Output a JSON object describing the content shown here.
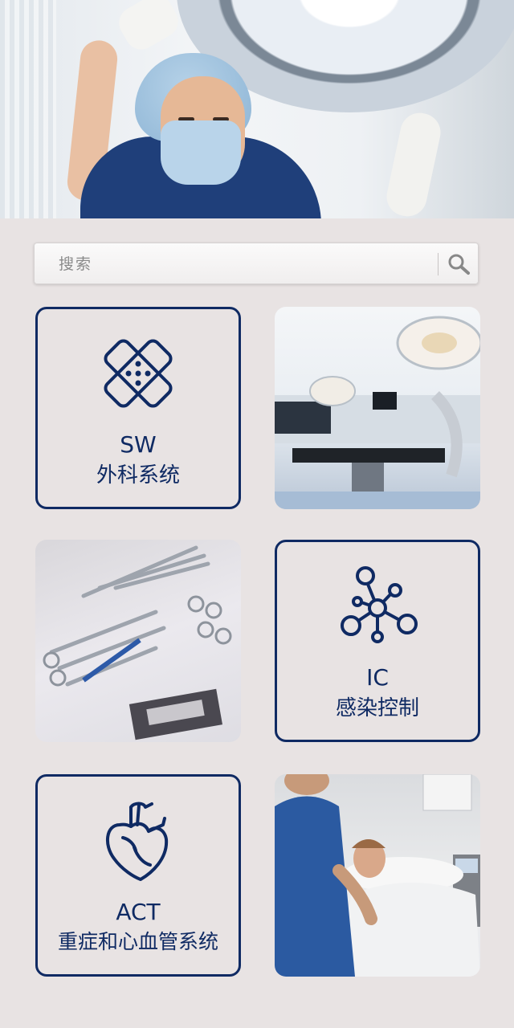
{
  "search": {
    "placeholder": "搜索"
  },
  "tiles": [
    {
      "code": "SW",
      "name": "外科系统",
      "icon": "bandage-icon"
    },
    {
      "photo": "operating-room-photo"
    },
    {
      "photo": "surgical-instruments-photo"
    },
    {
      "code": "IC",
      "name": "感染控制",
      "icon": "molecule-icon"
    },
    {
      "code": "ACT",
      "name": "重症和心血管系统",
      "icon": "heart-icon"
    },
    {
      "photo": "nurse-patient-photo"
    }
  ],
  "colors": {
    "brand_navy": "#0f2a63",
    "background": "#e8e3e3"
  }
}
